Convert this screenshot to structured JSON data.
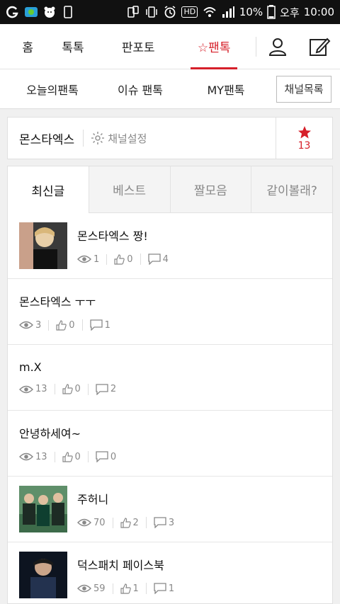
{
  "status_bar": {
    "battery": "10%",
    "ampm": "오후",
    "time": "10:00",
    "hd_label": "HD"
  },
  "main_nav": {
    "items": [
      {
        "label": "홈"
      },
      {
        "label": "톡톡"
      },
      {
        "label": "판포토"
      },
      {
        "label": "☆팬톡"
      }
    ]
  },
  "sub_nav": {
    "items": [
      {
        "label": "오늘의팬톡"
      },
      {
        "label": "이슈 팬톡"
      },
      {
        "label": "MY팬톡"
      }
    ],
    "channel_list": "채널목록"
  },
  "channel": {
    "name": "몬스타엑스",
    "settings": "채널설정",
    "star_count": "13"
  },
  "tabs": [
    {
      "label": "최신글",
      "active": true
    },
    {
      "label": "베스트",
      "active": false
    },
    {
      "label": "짤모음",
      "active": false
    },
    {
      "label": "같이볼래?",
      "active": false
    }
  ],
  "posts": [
    {
      "title": "몬스타엑스 짱!",
      "views": "1",
      "likes": "0",
      "comments": "4",
      "has_thumb": true
    },
    {
      "title": "몬스타엑스 ㅜㅜ",
      "views": "3",
      "likes": "0",
      "comments": "1",
      "has_thumb": false
    },
    {
      "title": "m.X",
      "views": "13",
      "likes": "0",
      "comments": "2",
      "has_thumb": false
    },
    {
      "title": "안녕하세여~",
      "views": "13",
      "likes": "0",
      "comments": "0",
      "has_thumb": false
    },
    {
      "title": "주허니",
      "views": "70",
      "likes": "2",
      "comments": "3",
      "has_thumb": true
    },
    {
      "title": "덕스패치 페이스북",
      "views": "59",
      "likes": "1",
      "comments": "1",
      "has_thumb": true
    }
  ],
  "colors": {
    "accent": "#d6202a",
    "status_bar": "#111111"
  }
}
